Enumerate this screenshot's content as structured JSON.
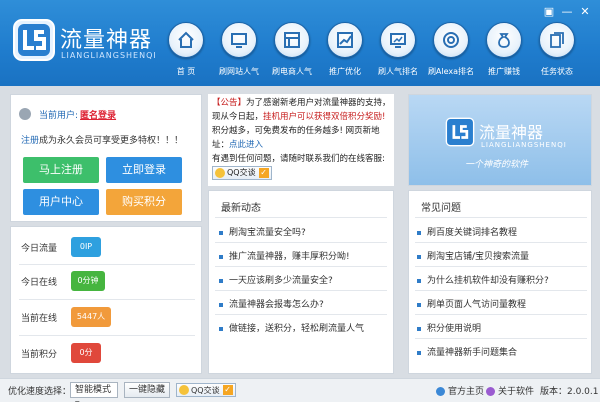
{
  "app": {
    "title": "流量神器",
    "subtitle": "LIANGLIANGSHENQI"
  },
  "window": {
    "restore_glyph": "▣",
    "minimize_glyph": "—",
    "close_glyph": "✕"
  },
  "nav": [
    {
      "label": "首  页",
      "icon": "home-icon"
    },
    {
      "label": "刷网站人气",
      "icon": "monitor-icon"
    },
    {
      "label": "刷电商人气",
      "icon": "shop-icon"
    },
    {
      "label": "推广优化",
      "icon": "chart-icon"
    },
    {
      "label": "刷人气排名",
      "icon": "screen-chart-icon"
    },
    {
      "label": "刷Alexa排名",
      "icon": "at-icon"
    },
    {
      "label": "推广赚钱",
      "icon": "money-bag-icon"
    },
    {
      "label": "任务状态",
      "icon": "documents-icon"
    }
  ],
  "user": {
    "current_label": "当前用户:",
    "current_value": "匿名登录",
    "register_link": "注册",
    "register_note": "成为永久会员可享受更多特权！！！",
    "buttons": {
      "register": "马上注册",
      "login": "立即登录",
      "center": "用户中心",
      "buy": "购买积分"
    }
  },
  "stats": [
    {
      "label": "今日流量",
      "value": "0IP",
      "color": "#2ea0df"
    },
    {
      "label": "今日在线",
      "value": "0分钟",
      "color": "#46b53f"
    },
    {
      "label": "当前在线",
      "value": "5447人",
      "color": "#f19a3b"
    },
    {
      "label": "当前积分",
      "value": "0分",
      "color": "#e0483b"
    }
  ],
  "notice": {
    "tag": "【公告】",
    "text1": "为了感谢新老用户对流量神器的支持，现从今日起，",
    "red": "挂机用户可以获得双倍积分奖励!",
    "text2": "积分越多，可免费发布的任务越多!  网页新地址：",
    "link": "点此进入",
    "text3": "有遇到任何问题，请随时联系我们的在线客服:",
    "qq_label": "QQ交谈"
  },
  "banner": {
    "title": "流量神器",
    "subtitle": "LIANGLIANGSHENQI",
    "slogan": "一个神奇的软件"
  },
  "news": {
    "title": "最新动态",
    "items": [
      "刷淘宝流量安全吗?",
      "推广流量神器，赚丰厚积分呦!",
      "一天应该刷多少流量安全?",
      "流量神器会报毒怎么办?",
      "做链接，送积分，轻松刷流量人气"
    ]
  },
  "faq": {
    "title": "常见问题",
    "items": [
      "刷百度关键词排名教程",
      "刷淘宝店铺/宝贝搜索流量",
      "为什么挂机软件却没有赚积分?",
      "刷单页面人气访问量教程",
      "积分使用说明",
      "流量神器新手问题集合"
    ]
  },
  "footer": {
    "speed_label": "优化速度选择：",
    "speed_value": "智能模式",
    "hide_button": "一键隐藏",
    "qq_label": "QQ交谈",
    "homepage": "官方主页",
    "about": "关于软件",
    "version": "版本：2.0.0.1"
  }
}
